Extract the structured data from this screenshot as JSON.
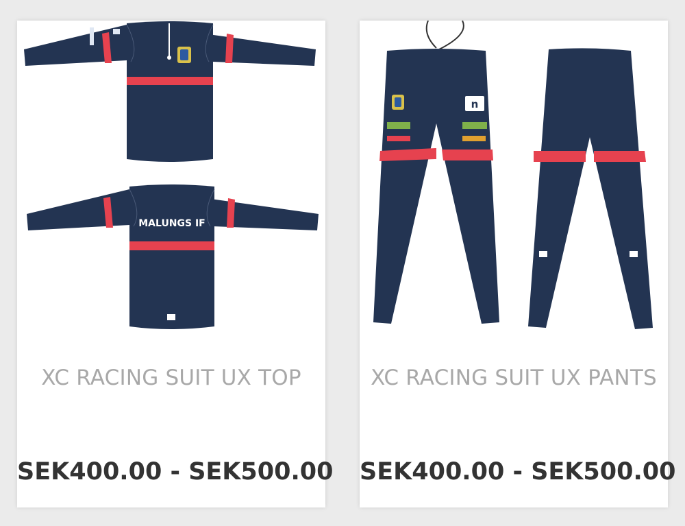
{
  "products": [
    {
      "title": "XC RACING SUIT UX TOP",
      "price": "SEK400.00 - SEK500.00",
      "image": {
        "back_print": "MALUNGS IF",
        "logo_icon": "n-brand-icon"
      }
    },
    {
      "title": "XC RACING SUIT UX PANTS",
      "price": "SEK400.00 - SEK500.00",
      "image": {
        "logo_icon": "n-brand-icon"
      }
    }
  ],
  "colors": {
    "navy": "#233452",
    "stripe": "#e6424f",
    "title": "#a8a8a8",
    "price": "#333333"
  }
}
